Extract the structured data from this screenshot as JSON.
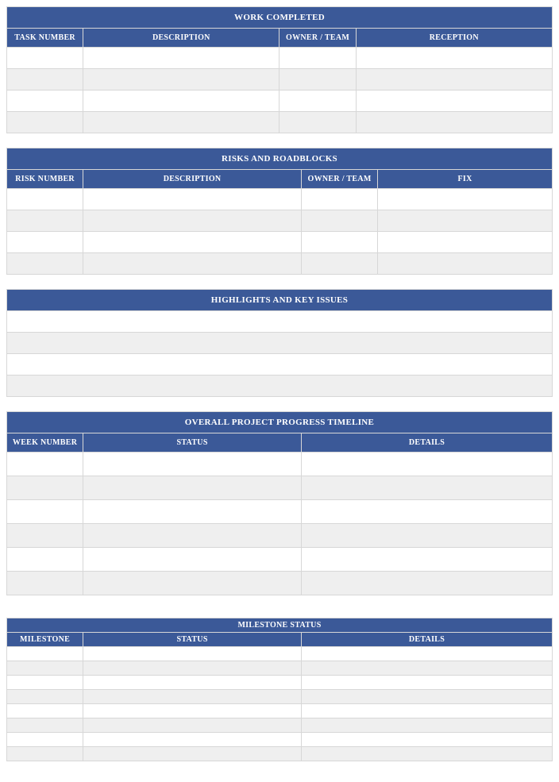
{
  "work_completed": {
    "title": "WORK COMPLETED",
    "headers": {
      "c1": "TASK NUMBER",
      "c2": "DESCRIPTION",
      "c3": "OWNER / TEAM",
      "c4": "RECEPTION"
    },
    "rows": [
      {
        "c1": "",
        "c2": "",
        "c3": "",
        "c4": ""
      },
      {
        "c1": "",
        "c2": "",
        "c3": "",
        "c4": ""
      },
      {
        "c1": "",
        "c2": "",
        "c3": "",
        "c4": ""
      },
      {
        "c1": "",
        "c2": "",
        "c3": "",
        "c4": ""
      }
    ]
  },
  "risks": {
    "title": "RISKS AND ROADBLOCKS",
    "headers": {
      "c1": "RISK NUMBER",
      "c2": "DESCRIPTION",
      "c3": "OWNER / TEAM",
      "c4": "FIX"
    },
    "rows": [
      {
        "c1": "",
        "c2": "",
        "c3": "",
        "c4": ""
      },
      {
        "c1": "",
        "c2": "",
        "c3": "",
        "c4": ""
      },
      {
        "c1": "",
        "c2": "",
        "c3": "",
        "c4": ""
      },
      {
        "c1": "",
        "c2": "",
        "c3": "",
        "c4": ""
      }
    ]
  },
  "highlights": {
    "title": "HIGHLIGHTS AND KEY ISSUES",
    "rows": [
      "",
      "",
      "",
      ""
    ]
  },
  "timeline": {
    "title": "OVERALL PROJECT PROGRESS TIMELINE",
    "headers": {
      "c1": "WEEK NUMBER",
      "c2": "STATUS",
      "c3": "DETAILS"
    },
    "rows": [
      {
        "c1": "",
        "c2": "",
        "c3": ""
      },
      {
        "c1": "",
        "c2": "",
        "c3": ""
      },
      {
        "c1": "",
        "c2": "",
        "c3": ""
      },
      {
        "c1": "",
        "c2": "",
        "c3": ""
      },
      {
        "c1": "",
        "c2": "",
        "c3": ""
      },
      {
        "c1": "",
        "c2": "",
        "c3": ""
      }
    ]
  },
  "milestone": {
    "title": "MILESTONE STATUS",
    "headers": {
      "c1": "MILESTONE",
      "c2": "STATUS",
      "c3": "DETAILS"
    },
    "rows": [
      {
        "c1": "",
        "c2": "",
        "c3": ""
      },
      {
        "c1": "",
        "c2": "",
        "c3": ""
      },
      {
        "c1": "",
        "c2": "",
        "c3": ""
      },
      {
        "c1": "",
        "c2": "",
        "c3": ""
      },
      {
        "c1": "",
        "c2": "",
        "c3": ""
      },
      {
        "c1": "",
        "c2": "",
        "c3": ""
      },
      {
        "c1": "",
        "c2": "",
        "c3": ""
      },
      {
        "c1": "",
        "c2": "",
        "c3": ""
      }
    ]
  }
}
